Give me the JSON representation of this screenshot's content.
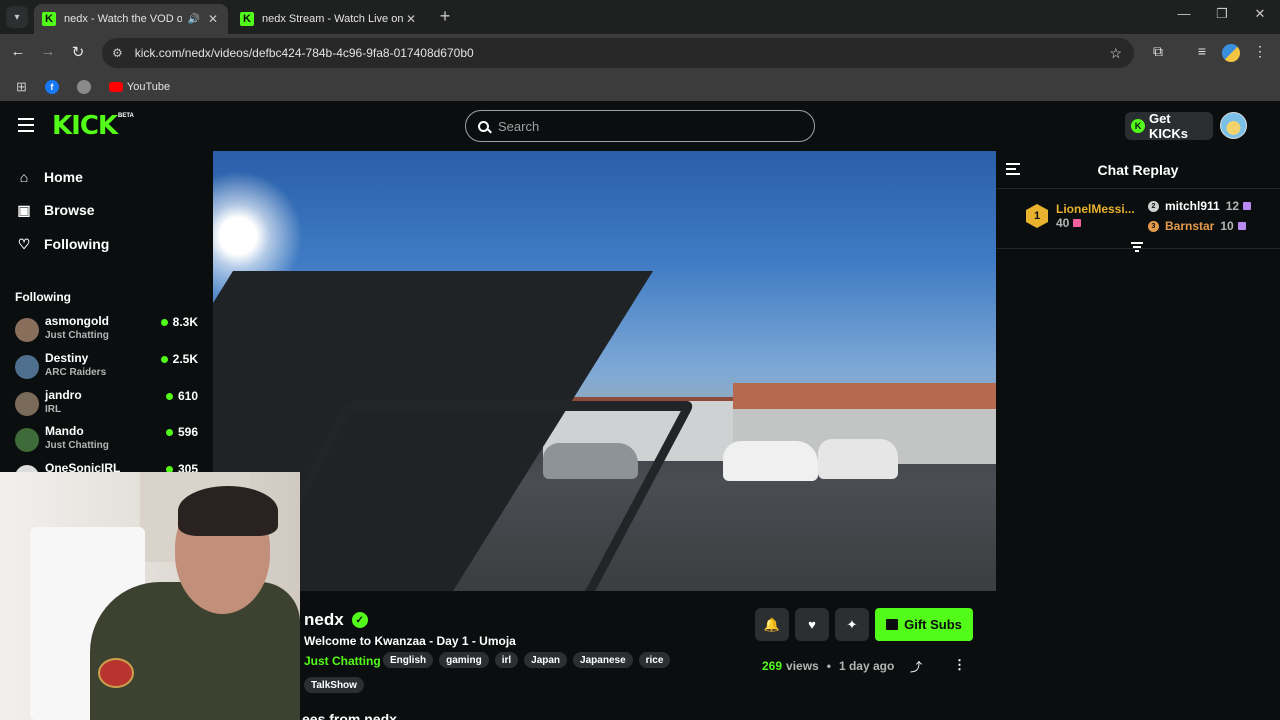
{
  "browser": {
    "tabs": [
      {
        "title": "nedx - Watch the VOD on Kick",
        "favicon": "kick-icon",
        "audio": true
      },
      {
        "title": "nedx Stream - Watch Live on Kick",
        "favicon": "kick-icon",
        "audio": false
      }
    ],
    "url": "kick.com/nedx/videos/defbc424-784b-4c96-9fa8-017408d670b0",
    "bookmarks": [
      {
        "label": "",
        "icon": "facebook-icon"
      },
      {
        "label": "",
        "icon": "globe-icon"
      },
      {
        "label": "YouTube",
        "icon": "youtube-icon"
      }
    ]
  },
  "header": {
    "logo": "KICK",
    "logo_badge": "BETA",
    "search_placeholder": "Search",
    "get_kicks_label": "Get KICKs"
  },
  "sidebar": {
    "nav": [
      {
        "label": "Home",
        "icon": "home-icon"
      },
      {
        "label": "Browse",
        "icon": "browse-icon"
      },
      {
        "label": "Following",
        "icon": "heart-icon"
      }
    ],
    "following_heading": "Following",
    "channels": [
      {
        "name": "asmongold",
        "category": "Just Chatting",
        "viewers": "8.3K"
      },
      {
        "name": "Destiny",
        "category": "ARC Raiders",
        "viewers": "2.5K"
      },
      {
        "name": "jandro",
        "category": "IRL",
        "viewers": "610"
      },
      {
        "name": "Mando",
        "category": "Just Chatting",
        "viewers": "596"
      },
      {
        "name": "OneSonicIRL",
        "category": "",
        "viewers": "305"
      }
    ]
  },
  "stream": {
    "streamer": "nedx",
    "title": "Welcome to Kwanzaa - Day 1 - Umoja",
    "category": "Just Chatting",
    "tags": [
      "English",
      "gaming",
      "irl",
      "Japan",
      "Japanese",
      "rice",
      "TalkShow"
    ],
    "gift_label": "Gift Subs",
    "views_count": "269",
    "views_label": "views",
    "separator": "•",
    "age": "1 day ago",
    "more_from": "ees from nedx"
  },
  "chat": {
    "title": "Chat Replay",
    "leaderboard": [
      {
        "rank": "1",
        "name": "LionelMessi...",
        "count": "40"
      },
      {
        "rank": "2",
        "name": "mitchl911",
        "count": "12"
      },
      {
        "rank": "3",
        "name": "Barnstar",
        "count": "10"
      }
    ]
  },
  "colors": {
    "accent": "#53fc18",
    "background": "#0b0e0f",
    "gold": "#e8b12e",
    "bronze": "#e39a4c"
  }
}
